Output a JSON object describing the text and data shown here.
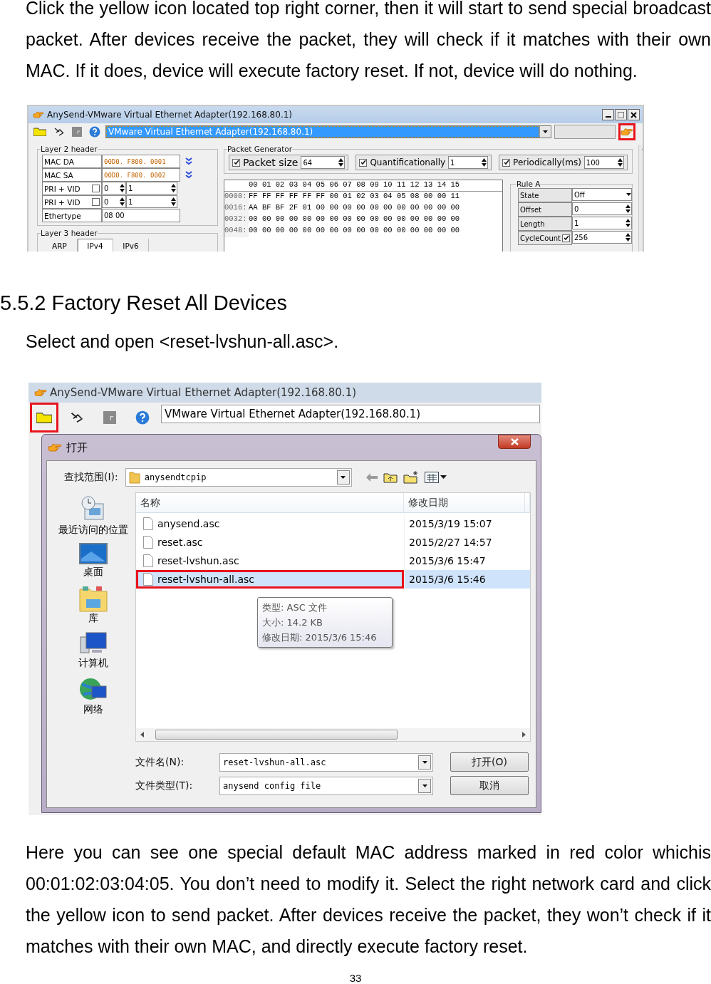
{
  "intro_paragraph": "Click the yellow icon located top right corner, then it will start to send special broadcast packet. After devices receive the packet, they will check if it matches with their own MAC. If it does, device will execute factory reset. If not, device will do nothing.",
  "screenshot_1": {
    "window_title": "AnySend-VMware Virtual Ethernet Adapter(192.168.80.1)",
    "toolbar": [
      {
        "kind": "open",
        "highlighted": false
      },
      {
        "kind": "scan",
        "highlighted": false
      },
      {
        "kind": "stop",
        "highlighted": false
      },
      {
        "kind": "help",
        "highlighted": false
      }
    ],
    "adapter": "VMware Virtual Ethernet Adapter(192.168.80.1)",
    "send_button": {
      "highlighted": true
    },
    "layer2": {
      "title": "Layer 2 header",
      "rows": [
        {
          "kind": "mac",
          "label": "MAC DA",
          "value": "00D0. F800. 0001"
        },
        {
          "kind": "mac",
          "label": "MAC SA",
          "value": "00D0. F800. 0002"
        },
        {
          "kind": "vlan",
          "label": "PRI + VID",
          "checked": false,
          "pri": "0",
          "vid": "1"
        },
        {
          "kind": "vlan",
          "label": "PRI + VID",
          "checked": false,
          "pri": "0",
          "vid": "1"
        },
        {
          "kind": "text",
          "label": "Ethertype",
          "value": "08 00"
        }
      ]
    },
    "layer3": {
      "title": "Layer 3 header",
      "tabs": [
        {
          "label": "ARP",
          "selected": false
        },
        {
          "label": "IPv4",
          "selected": true
        },
        {
          "label": "IPv6",
          "selected": false
        }
      ]
    },
    "packet_generator": {
      "title": "Packet Generator",
      "options": [
        {
          "label": "Packet size",
          "checked": true,
          "value": "64"
        },
        {
          "label": "Quantificationally",
          "checked": true,
          "value": "1"
        },
        {
          "label": "Periodically(ms)",
          "checked": true,
          "value": "100"
        }
      ]
    },
    "hex": {
      "header": "00 01 02 03 04 05 06 07 08 09 10 11 12 13 14 15",
      "rows": [
        {
          "offset": "0000:",
          "bytes": "FF FF FF FF FF FF 00 01 02 03 04 05 08 00 00 11"
        },
        {
          "offset": "0016:",
          "bytes": "AA BF BF 2F 01 00 00 00 00 00 00 00 00 00 00 00"
        },
        {
          "offset": "0032:",
          "bytes": "00 00 00 00 00 00 00 00 00 00 00 00 00 00 00 00"
        },
        {
          "offset": "0048:",
          "bytes": "00 00 00 00 00 00 00 00 00 00 00 00 00 00 00 00"
        }
      ]
    },
    "rule": {
      "title": "Rule A",
      "rows": [
        {
          "kind": "dropdown",
          "label": "State",
          "value": "Off"
        },
        {
          "kind": "spin",
          "label": "Offset",
          "value": "0"
        },
        {
          "kind": "spin",
          "label": "Length",
          "value": "1"
        },
        {
          "kind": "check_spin",
          "label": "CycleCount",
          "checked": true,
          "value": "256"
        }
      ]
    }
  },
  "heading": "5.5.2 Factory Reset All Devices",
  "instruction": "Select and open <reset-lvshun-all.asc>.",
  "screenshot_2": {
    "window_title": "AnySend-VMware Virtual Ethernet Adapter(192.168.80.1)",
    "toolbar": [
      {
        "kind": "open",
        "highlighted": true
      },
      {
        "kind": "scan",
        "highlighted": false
      },
      {
        "kind": "stop",
        "highlighted": false
      },
      {
        "kind": "help",
        "highlighted": false
      }
    ],
    "adapter": "VMware Virtual Ethernet Adapter(192.168.80.1)",
    "dialog": {
      "title": "打开",
      "look_in_label": "查找范围(I):",
      "folder": "anysendtcpip",
      "places": [
        {
          "kind": "recent",
          "label": "最近访问的位置"
        },
        {
          "kind": "desktop",
          "label": "桌面"
        },
        {
          "kind": "library",
          "label": "库"
        },
        {
          "kind": "computer",
          "label": "计算机"
        },
        {
          "kind": "network",
          "label": "网络"
        }
      ],
      "columns": [
        "名称",
        "修改日期"
      ],
      "files": [
        {
          "name": "anysend.asc",
          "date": "2015/3/19 15:07",
          "selected": false,
          "highlighted": false
        },
        {
          "name": "reset.asc",
          "date": "2015/2/27 14:57",
          "selected": false,
          "highlighted": false
        },
        {
          "name": "reset-lvshun.asc",
          "date": "2015/3/6 15:47",
          "selected": false,
          "highlighted": false
        },
        {
          "name": "reset-lvshun-all.asc",
          "date": "2015/3/6 15:46",
          "selected": true,
          "highlighted": true
        }
      ],
      "tooltip": [
        "类型: ASC 文件",
        "大小: 14.2 KB",
        "修改日期: 2015/3/6 15:46"
      ],
      "filename_label": "文件名(N):",
      "filename": "reset-lvshun-all.asc",
      "filetype_label": "文件类型(T):",
      "filetype": "anysend config file",
      "buttons": [
        "打开(O)",
        "取消"
      ]
    }
  },
  "closing_paragraph": "Here you can see one special default MAC address marked in red color whichis 00:01:02:03:04:05. You don’t need to modify it. Select the right network card and click the yellow icon to send packet. After devices receive the packet, they won’t check if it matches with their own MAC, and directly execute factory reset.",
  "page_number": "33"
}
